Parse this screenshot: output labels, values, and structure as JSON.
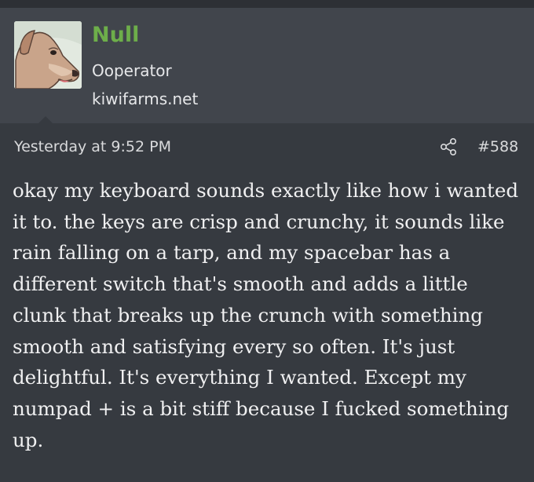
{
  "author": {
    "name": "Null",
    "title": "Ooperator",
    "site": "kiwifarms.net",
    "avatar_icon": "dog-avatar-icon",
    "name_color": "#6dae4a"
  },
  "post": {
    "timestamp": "Yesterday at 9:52 PM",
    "share_icon": "share-icon",
    "number": "#588",
    "body": "okay my keyboard sounds exactly like how i wanted it to. the keys are crisp and crunchy, it sounds like rain falling on a tarp, and my spacebar has a different switch that's smooth and adds a little clunk that breaks up the crunch with something smooth and satisfying every so often. It's just delightful. It's everything I wanted. Except my numpad + is a bit stiff because I fucked something up."
  }
}
